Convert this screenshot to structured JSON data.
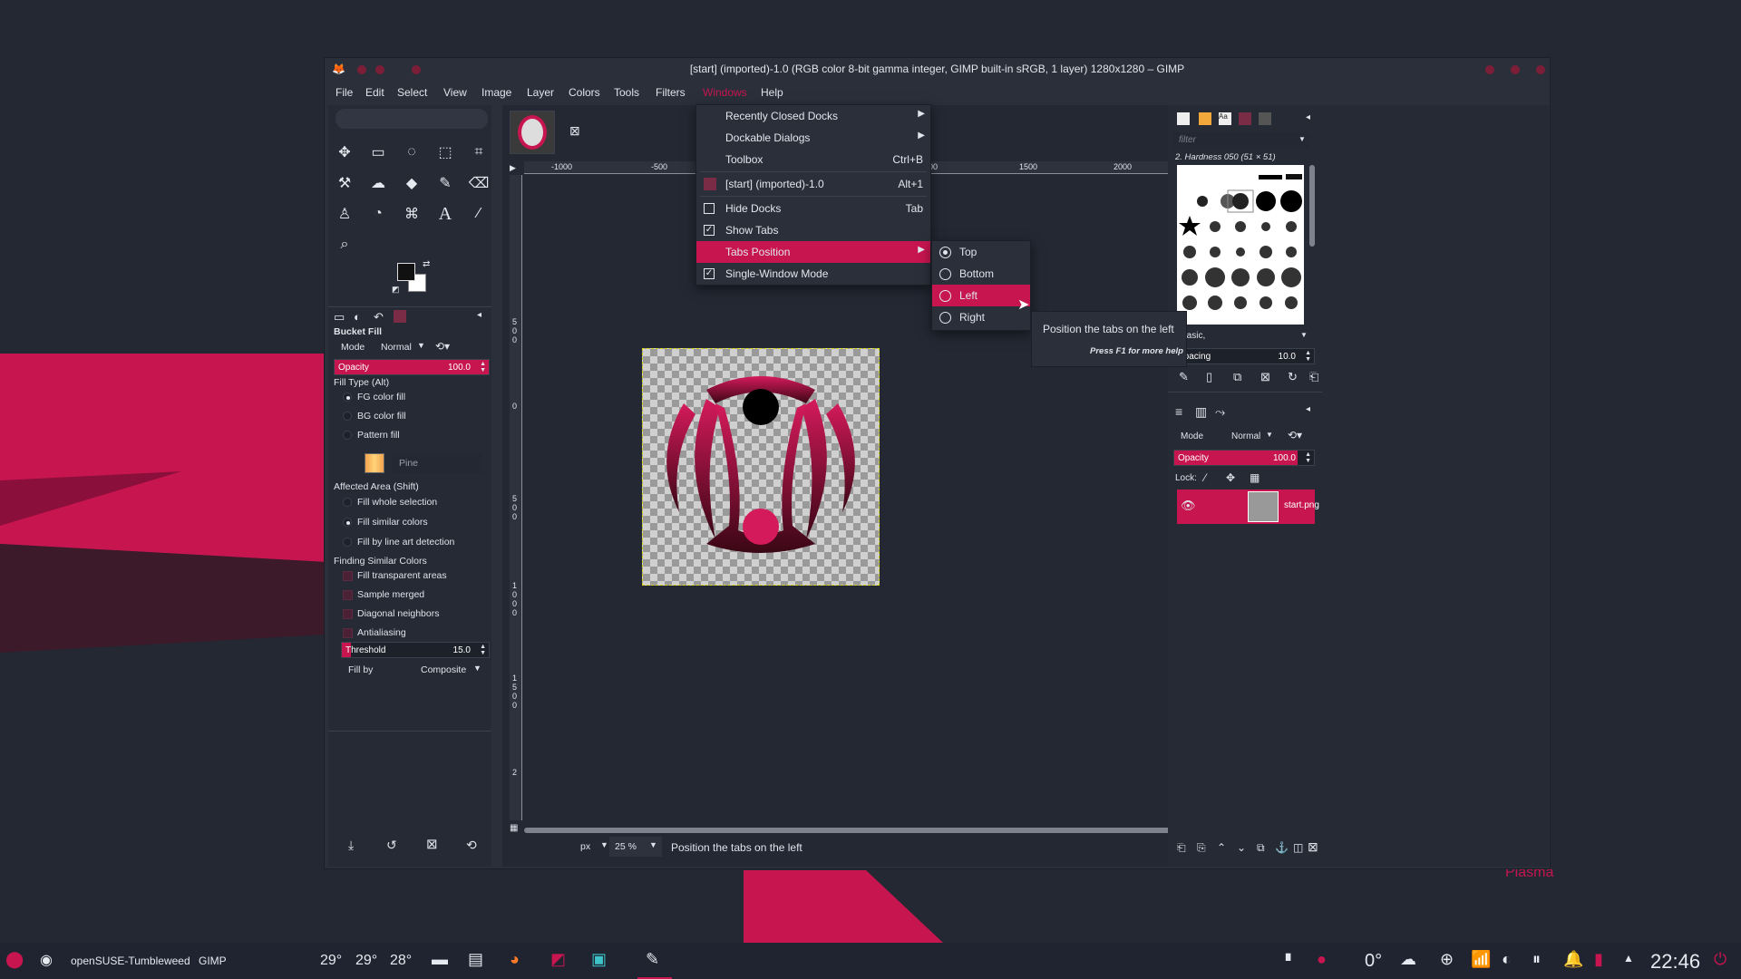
{
  "window": {
    "title": "[start] (imported)-1.0 (RGB color 8-bit gamma integer, GIMP built-in sRGB, 1 layer) 1280x1280 – GIMP"
  },
  "menubar": [
    "File",
    "Edit",
    "Select",
    "View",
    "Image",
    "Layer",
    "Colors",
    "Tools",
    "Filters",
    "Windows",
    "Help"
  ],
  "windows_menu": {
    "items": [
      {
        "label": "Recently Closed Docks",
        "shortcut": ""
      },
      {
        "label": "Dockable Dialogs",
        "shortcut": ""
      },
      {
        "label": "Toolbox",
        "shortcut": "Ctrl+B"
      },
      {
        "label": "[start] (imported)-1.0",
        "shortcut": "Alt+1"
      },
      {
        "label": "Hide Docks",
        "shortcut": "Tab"
      },
      {
        "label": "Show Tabs",
        "shortcut": ""
      },
      {
        "label": "Tabs Position",
        "shortcut": ""
      },
      {
        "label": "Single-Window Mode",
        "shortcut": ""
      }
    ]
  },
  "tabs_position_menu": [
    "Top",
    "Bottom",
    "Left",
    "Right"
  ],
  "tooltip": {
    "text": "Position the tabs on the left",
    "help": "Press F1 for more help"
  },
  "tool_options": {
    "title": "Bucket Fill",
    "mode_label": "Mode",
    "mode_value": "Normal",
    "opacity_label": "Opacity",
    "opacity_value": "100.0",
    "opacity_fraction": 1.0,
    "fill_type_label": "Fill Type  (Alt)",
    "fill_types": [
      "FG color fill",
      "BG color fill",
      "Pattern fill"
    ],
    "pattern_name": "Pine",
    "affected_label": "Affected Area  (Shift)",
    "affected": [
      "Fill whole selection",
      "Fill similar colors",
      "Fill by line art detection"
    ],
    "finding_label": "Finding Similar Colors",
    "finding": [
      "Fill transparent areas",
      "Sample merged",
      "Diagonal neighbors",
      "Antialiasing"
    ],
    "threshold_label": "Threshold",
    "threshold_value": "15.0",
    "threshold_fraction": 0.06,
    "fillby_label": "Fill by",
    "fillby_value": "Composite"
  },
  "rulers": {
    "top": [
      "-1000",
      "-500",
      "1000",
      "1500",
      "2000"
    ],
    "left": [
      "5",
      "0",
      "0",
      "0",
      "5",
      "0",
      "0",
      "1",
      "0",
      "0",
      "0",
      "1",
      "5",
      "0",
      "0",
      "2"
    ]
  },
  "status": {
    "unit": "px",
    "zoom": "25 %",
    "message": "Position the tabs on the left"
  },
  "brushes": {
    "filter_placeholder": "filter",
    "brush_name": "2. Hardness 050 (51 × 51)",
    "preset": "Basic,",
    "spacing_label": "Spacing",
    "spacing_value": "10.0"
  },
  "layers": {
    "mode_label": "Mode",
    "mode_value": "Normal",
    "opacity_label": "Opacity",
    "opacity_value": "100.0",
    "lock_label": "Lock:",
    "layer_name": "start.png"
  },
  "taskbar": {
    "distro": "openSUSE-Tumbleweed",
    "app": "GIMP",
    "temps": [
      "29°",
      "29°",
      "28°"
    ],
    "weather": "0°",
    "clock": "22:46"
  },
  "wallpaper_brand": "Plasma",
  "colors": {
    "accent": "#c7154f",
    "bg": "#232833",
    "panel": "#2a2f3a"
  }
}
